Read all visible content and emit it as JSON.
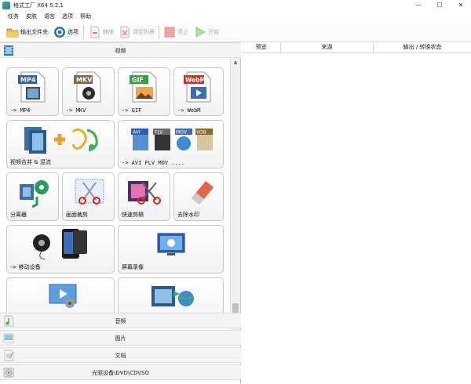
{
  "window": {
    "title": "格式工厂 X64 5.2.1",
    "controls": {
      "minimize": "—",
      "maximize": "☐",
      "close": "✕"
    }
  },
  "menu": [
    "任务",
    "皮肤",
    "语言",
    "选项",
    "帮助"
  ],
  "toolbar": {
    "output_folder": "输出文件夹",
    "options": "选项",
    "remove": "移除",
    "clear_list": "清空列表",
    "stop": "停止",
    "start": "开始"
  },
  "left": {
    "categories": {
      "video": "视频",
      "audio": "音频",
      "image": "图片",
      "document": "文档",
      "disc": "光驱设备\\DVD\\CD\\ISO"
    },
    "tiles": [
      {
        "label": "-> MP4",
        "badge": "MP4",
        "badge_color": "#2f5fb3"
      },
      {
        "label": "-> MKV",
        "badge": "MKV",
        "badge_color": "#7a6a4a"
      },
      {
        "label": "-> GIF",
        "badge": "GIF",
        "badge_color": "#3f9b3f"
      },
      {
        "label": "-> WebM",
        "badge": "WebM",
        "badge_color": "#c0392b"
      },
      {
        "label": "视频合并 & 混流"
      },
      {
        "label": "-> AVI FLV MOV ....",
        "badges": [
          "AVI",
          "FLV",
          "MOV",
          "VOB"
        ]
      },
      {
        "label": "分离器"
      },
      {
        "label": "画面裁剪"
      },
      {
        "label": "快速剪辑"
      },
      {
        "label": "去除水印"
      },
      {
        "label": "-> 移动设备"
      },
      {
        "label": "屏幕录像"
      },
      {
        "label": ""
      },
      {
        "label": ""
      }
    ]
  },
  "right": {
    "columns": [
      "预览",
      "来源",
      "输出 / 转换状态"
    ]
  },
  "scrollbar": {
    "up": "▲",
    "down": "▼"
  },
  "colors": {
    "accent_blue": "#1c7fd6",
    "accent_green": "#3fb24a",
    "tile_border": "#c9c9c9"
  }
}
